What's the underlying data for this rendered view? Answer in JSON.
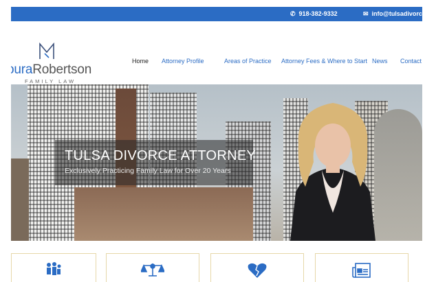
{
  "topbar": {
    "phone": "918-382-9332",
    "email": "info@tulsadivorce.con",
    "phone_icon": "phone-icon",
    "email_icon": "envelope-icon",
    "bg_color": "#2b6cc4"
  },
  "logo": {
    "name_accent": "oura",
    "name_rest": "Robertson",
    "tagline": "FAMILY LAW"
  },
  "nav": {
    "items": [
      {
        "label": "Home",
        "active": true
      },
      {
        "label": "Attorney Profile",
        "active": false
      },
      {
        "label": "Areas of Practice",
        "active": false
      },
      {
        "label": "Attorney Fees & Where to Start",
        "active": false
      },
      {
        "label": "News",
        "active": false
      },
      {
        "label": "Contact U",
        "active": false
      }
    ],
    "link_color": "#2b6cc4"
  },
  "hero": {
    "title": "TULSA DIVORCE ATTORNEY",
    "subtitle": "Exclusively Practicing Family Law for Over 20 Years"
  },
  "cards": [
    {
      "icon": "family-icon"
    },
    {
      "icon": "scales-of-justice-icon"
    },
    {
      "icon": "broken-heart-icon"
    },
    {
      "icon": "newspaper-icon"
    }
  ],
  "colors": {
    "accent": "#2b6cc4",
    "card_border": "#e6d7a8"
  }
}
